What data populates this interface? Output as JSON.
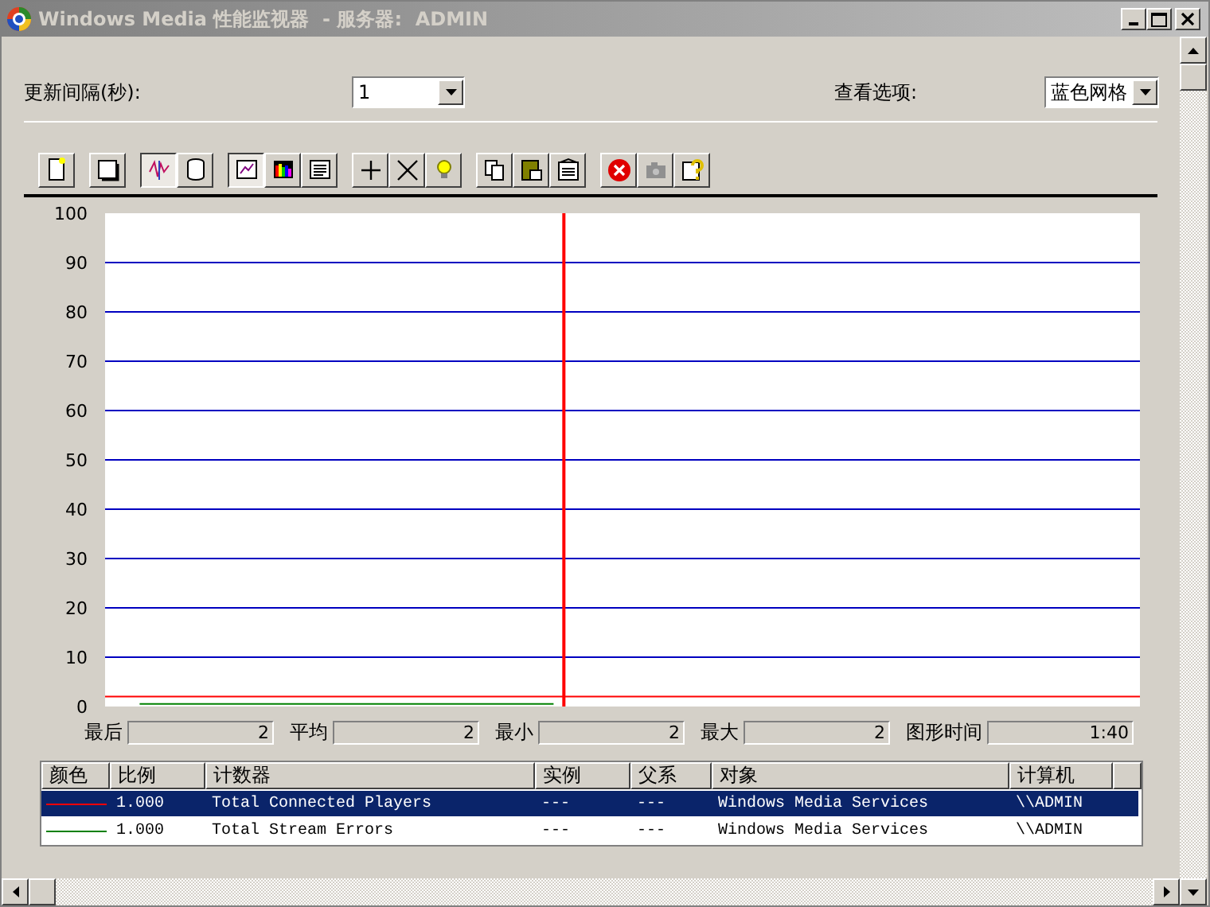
{
  "window": {
    "title": "Windows Media 性能监视器  - 服务器:  ADMIN",
    "active": false
  },
  "update_interval": {
    "label": "更新间隔(秒):",
    "value": "1"
  },
  "view_options": {
    "label": "查看选项:",
    "value": "蓝色网格"
  },
  "toolbar": [
    {
      "selected": false
    },
    {
      "selected": false
    },
    {
      "selected": true
    },
    {
      "selected": false
    },
    {
      "selected": true
    },
    {
      "selected": false
    },
    {
      "selected": false
    },
    {
      "selected": false
    },
    {
      "selected": false
    },
    {
      "selected": false
    },
    {
      "selected": false
    },
    {
      "selected": false
    },
    {
      "selected": false
    },
    {
      "selected": false
    },
    {
      "selected": false
    },
    {
      "selected": false
    }
  ],
  "chart": {
    "chart_data": {
      "type": "line",
      "grid": true,
      "ylim": [
        0,
        100
      ],
      "yticks": [
        0,
        10,
        20,
        30,
        40,
        50,
        60,
        70,
        80,
        90,
        100
      ],
      "series": [
        {
          "color": "#ff0000",
          "values": [
            2,
            2,
            2,
            2,
            2,
            2,
            2,
            2,
            2,
            2,
            2,
            2,
            2,
            2,
            2,
            2,
            2,
            2,
            2,
            2,
            2,
            2,
            2,
            2,
            2,
            2,
            2,
            2,
            2,
            2,
            2
          ]
        },
        {
          "color": "#008000",
          "values": [
            null,
            0.5,
            0.5,
            0.5,
            0.5,
            0.5,
            0.5,
            0.5,
            0.5,
            0.5,
            0.5,
            0.5,
            0.5,
            0.5,
            null,
            null,
            null,
            null,
            null,
            null,
            null,
            null,
            null,
            null,
            null,
            null,
            null,
            null,
            null,
            null,
            null
          ]
        }
      ]
    }
  },
  "stats": [
    {
      "label": "最后",
      "value": "2"
    },
    {
      "label": "平均",
      "value": "2"
    },
    {
      "label": "最小",
      "value": "2"
    },
    {
      "label": "最大",
      "value": "2"
    },
    {
      "label": "图形时间",
      "value": "1:40"
    }
  ],
  "table": {
    "columns": [
      "颜色",
      "比例",
      "计数器",
      "实例",
      "父系",
      "对象",
      "计算机"
    ],
    "rows": [
      {
        "color": "#ff0000",
        "scale": "1.000",
        "counter": "Total Connected Players",
        "instance": "---",
        "parent": "---",
        "object": "Windows Media Services",
        "computer": "\\\\ADMIN",
        "selected": true
      },
      {
        "color": "#008000",
        "scale": "1.000",
        "counter": "Total Stream Errors",
        "instance": "---",
        "parent": "---",
        "object": "Windows Media Services",
        "computer": "\\\\ADMIN",
        "selected": false
      }
    ]
  }
}
